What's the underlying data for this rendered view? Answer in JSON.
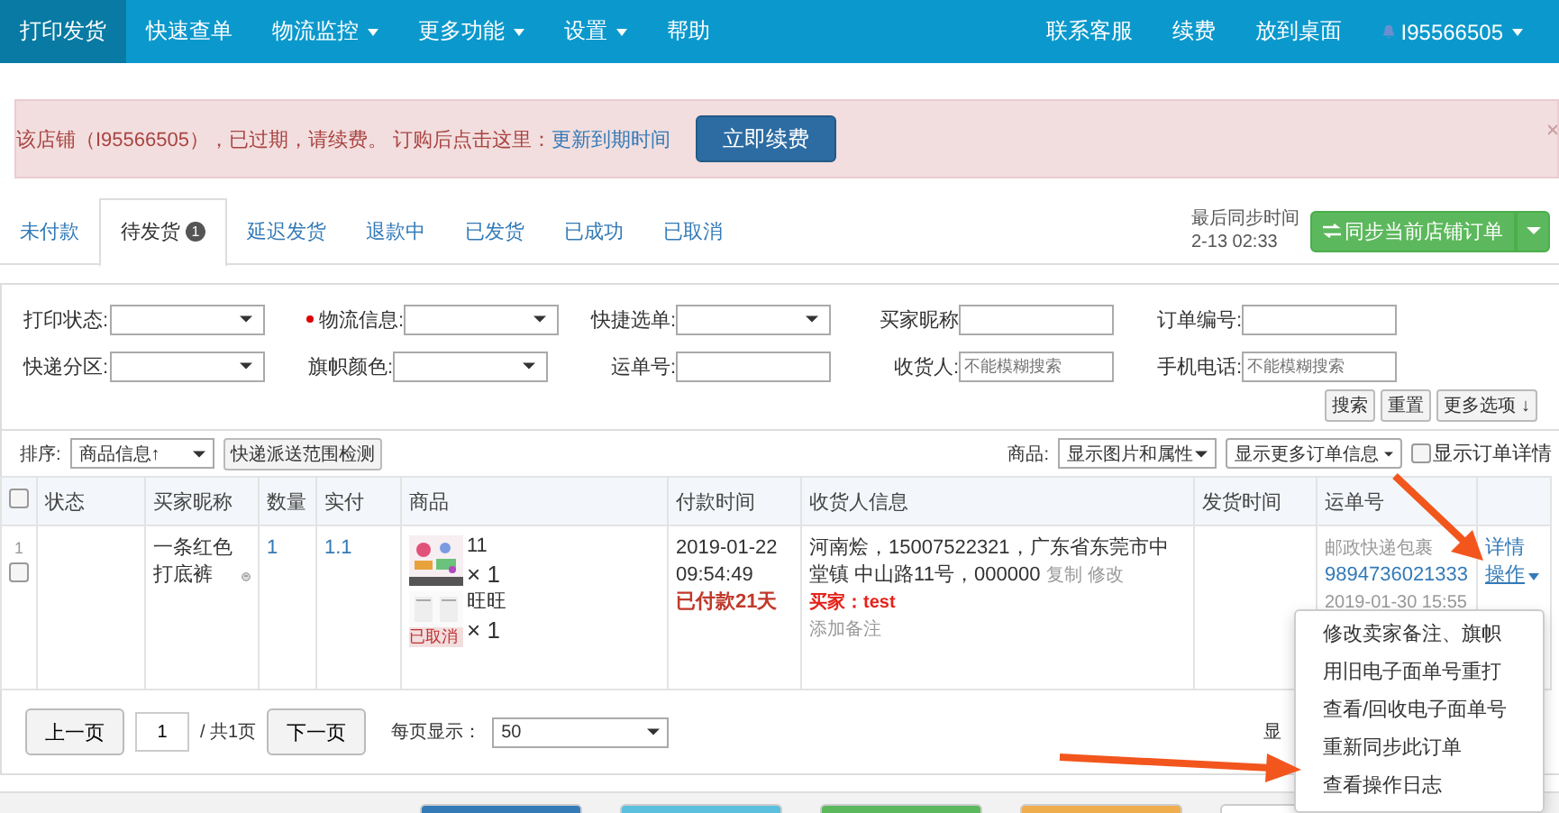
{
  "nav": {
    "left": [
      {
        "label": "打印发货",
        "caret": false,
        "selected": true
      },
      {
        "label": "快速查单",
        "caret": false,
        "selected": false
      },
      {
        "label": "物流监控",
        "caret": true,
        "selected": false
      },
      {
        "label": "更多功能",
        "caret": true,
        "selected": false
      },
      {
        "label": "设置",
        "caret": true,
        "selected": false
      },
      {
        "label": "帮助",
        "caret": false,
        "selected": false
      }
    ],
    "right": [
      "联系客服",
      "续费",
      "放到桌面"
    ],
    "user": "I95566505"
  },
  "alert": {
    "text": "该店铺（I95566505），已过期，请续费。 订购后点击这里：",
    "link": "更新到期时间",
    "button": "立即续费"
  },
  "tabs": [
    {
      "label": "未付款",
      "selected": false
    },
    {
      "label": "待发货",
      "selected": true,
      "badge": "1"
    },
    {
      "label": "延迟发货",
      "selected": false
    },
    {
      "label": "退款中",
      "selected": false
    },
    {
      "label": "已发货",
      "selected": false
    },
    {
      "label": "已成功",
      "selected": false
    },
    {
      "label": "已取消",
      "selected": false
    }
  ],
  "sync": {
    "label": "最后同步时间",
    "time": "2-13 02:33",
    "button": "同步当前店铺订单"
  },
  "filters": [
    [
      {
        "label": "打印状态:",
        "kind": "select",
        "required": false
      },
      {
        "label": "物流信息:",
        "kind": "select",
        "required": true
      },
      {
        "label": "快捷选单:",
        "kind": "select",
        "required": false
      },
      {
        "label": "买家昵称",
        "kind": "input",
        "required": false
      },
      {
        "label": "订单编号:",
        "kind": "input",
        "required": false
      }
    ],
    [
      {
        "label": "快递分区:",
        "kind": "select",
        "required": false
      },
      {
        "label": "旗帜颜色:",
        "kind": "select",
        "required": false
      },
      {
        "label": "运单号:",
        "kind": "input",
        "required": false
      },
      {
        "label": "收货人:",
        "kind": "input",
        "required": false,
        "placeholder": "不能模糊搜索"
      },
      {
        "label": "手机电话:",
        "kind": "input",
        "required": false,
        "placeholder": "不能模糊搜索"
      }
    ]
  ],
  "filter_buttons": [
    "搜索",
    "重置",
    "更多选项 ↓"
  ],
  "sortbar": {
    "label": "排序:",
    "sort": "商品信息↑",
    "check_button": "快递派送范围检测",
    "goods_label": "商品:",
    "goods": "显示图片和属性",
    "more_info": "显示更多订单信息",
    "detail": {
      "label": "显示订单详情",
      "checked": false
    }
  },
  "table": {
    "columns": [
      "状态",
      "买家昵称",
      "数量",
      "实付",
      "商品",
      "付款时间",
      "收货人信息",
      "发货时间",
      "运单号"
    ],
    "select_all": {
      "checked": false
    },
    "rows": [
      {
        "index": "1",
        "checked": false,
        "buyer": "一条红色打底裤",
        "qty": "1",
        "paid": "1.1",
        "items": [
          {
            "name": "11",
            "qty": "× 1",
            "cancelled": false
          },
          {
            "name": "旺旺",
            "qty": "× 1",
            "cancelled": true,
            "tag": "已取消"
          }
        ],
        "pay_time": "2019-01-22 09:54:49",
        "paid_days": "已付款21天",
        "receiver": "河南烩，15007522321，广东省东莞市中堂镇 中山路11号，000000",
        "copy": "复制",
        "edit": "修改",
        "buyer_note_label": "买家：",
        "buyer_note": "test",
        "add_note": "添加备注",
        "carrier": "邮政快递包裹",
        "tracking": "9894736021333",
        "ship_date": "2019-01-30 15:55",
        "detail_link": "详情",
        "ops_link": "操作"
      }
    ]
  },
  "menu": [
    "修改卖家备注、旗帜",
    "用旧电子面单号重打",
    "查看/回收电子面单号",
    "重新同步此订单",
    "查看操作日志"
  ],
  "pagination": {
    "prev": "上一页",
    "page": "1",
    "total": "/ 共1页",
    "next": "下一页",
    "per_page_label": "每页显示：",
    "per_page": "50",
    "right_text": "显"
  },
  "bottom_buttons": [
    {
      "color": "#337ab7"
    },
    {
      "color": "#5bc0de"
    },
    {
      "color": "#5cb85c"
    },
    {
      "color": "#f0ad4e"
    },
    {
      "color": "#ffffff"
    }
  ]
}
